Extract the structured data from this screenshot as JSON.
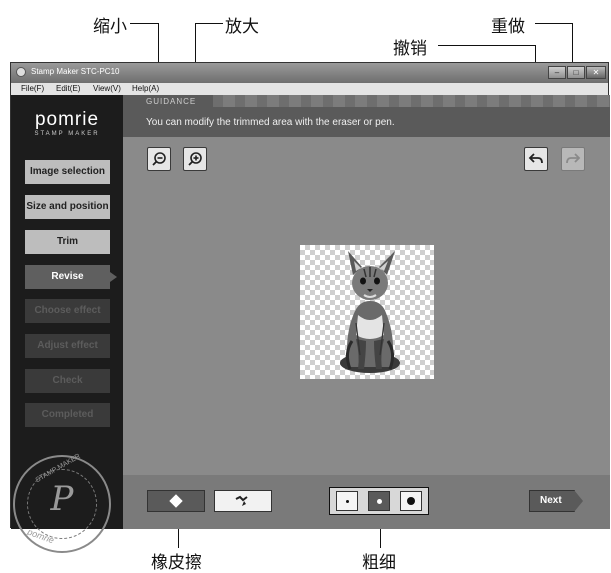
{
  "annotations": {
    "zoom_out": "缩小",
    "zoom_in": "放大",
    "undo": "撤销",
    "redo": "重做",
    "eraser": "橡皮擦",
    "thickness": "粗细"
  },
  "window": {
    "title": "Stamp Maker STC-PC10",
    "menu": [
      "File(F)",
      "Edit(E)",
      "View(V)",
      "Help(A)"
    ]
  },
  "sidebar": {
    "logo": "pomrie",
    "logo_sub": "STAMP MAKER",
    "steps": [
      {
        "label": "Image selection",
        "state": "done"
      },
      {
        "label": "Size and position",
        "state": "done"
      },
      {
        "label": "Trim",
        "state": "done"
      },
      {
        "label": "Revise",
        "state": "current"
      },
      {
        "label": "Choose effect",
        "state": "future"
      },
      {
        "label": "Adjust effect",
        "state": "future"
      },
      {
        "label": "Check",
        "state": "future"
      },
      {
        "label": "Completed",
        "state": "future"
      }
    ],
    "stamp": {
      "top": "STAMP MAKER",
      "letter": "P",
      "bottom": "pomrie"
    }
  },
  "guidance": {
    "label": "GUIDANCE",
    "text": "You can modify the trimmed area with the eraser or pen."
  },
  "canvas": {
    "zoom_out_icon": "zoom-out-icon",
    "zoom_in_icon": "zoom-in-icon",
    "undo_icon": "undo-icon",
    "redo_icon": "redo-icon",
    "redo_enabled": false
  },
  "bottom": {
    "eraser_icon": "eraser-icon",
    "pen_icon": "pen-icon",
    "active_tool": "eraser",
    "sizes": [
      "small",
      "medium",
      "large"
    ],
    "selected_size": "medium",
    "next_label": "Next"
  }
}
